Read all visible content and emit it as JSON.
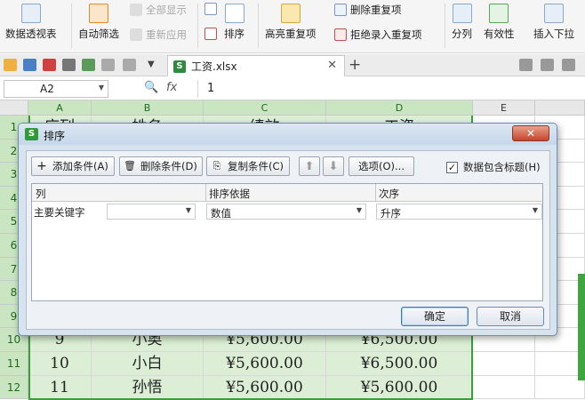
{
  "ribbon": {
    "pivot_table": "数据透视表",
    "auto_filter": "自动筛选",
    "show_all": "全部显示",
    "reapply": "重新应用",
    "sort": "排序",
    "highlight_duplicates": "高亮重复项",
    "remove_duplicates": "删除重复项",
    "reject_duplicates": "拒绝录入重复项",
    "split": "分列",
    "validity": "有效性",
    "insert_dropdown": "插入下拉"
  },
  "tabs": {
    "file_name": "工资.xlsx"
  },
  "formula_bar": {
    "cell_ref": "A2",
    "fx": "fx",
    "value": "1"
  },
  "sheet": {
    "columns": [
      "A",
      "B",
      "C",
      "D",
      "E"
    ],
    "header_row": [
      "序列",
      "姓名",
      "绩效",
      "工资",
      ""
    ],
    "rows": [
      {
        "num": "1",
        "cells": [
          "序列",
          "姓名",
          "绩效",
          "工资",
          ""
        ]
      },
      {
        "num": "2",
        "cells": [
          "",
          "",
          "",
          "",
          ""
        ]
      },
      {
        "num": "3",
        "cells": [
          "",
          "",
          "",
          "",
          ""
        ]
      },
      {
        "num": "4",
        "cells": [
          "",
          "",
          "",
          "",
          ""
        ]
      },
      {
        "num": "5",
        "cells": [
          "",
          "",
          "",
          "",
          ""
        ]
      },
      {
        "num": "6",
        "cells": [
          "",
          "",
          "",
          "",
          ""
        ]
      },
      {
        "num": "7",
        "cells": [
          "",
          "",
          "",
          "",
          ""
        ]
      },
      {
        "num": "8",
        "cells": [
          "",
          "",
          "",
          "",
          ""
        ]
      },
      {
        "num": "9",
        "cells": [
          "",
          "",
          "",
          "",
          ""
        ]
      },
      {
        "num": "10",
        "cells": [
          "9",
          "小奥",
          "¥5,600.00",
          "¥6,500.00",
          ""
        ]
      },
      {
        "num": "11",
        "cells": [
          "10",
          "小白",
          "¥5,600.00",
          "¥6,500.00",
          ""
        ]
      },
      {
        "num": "12",
        "cells": [
          "11",
          "孙悟",
          "¥5,600.00",
          "¥5,600.00",
          ""
        ]
      }
    ]
  },
  "dialog": {
    "title": "排序",
    "close": "✕",
    "add_condition": "添加条件(A)",
    "delete_condition": "删除条件(D)",
    "copy_condition": "复制条件(C)",
    "move_up": "⬆",
    "move_down": "⬇",
    "options": "选项(O)...",
    "header_checkbox": "数据包含标题(H)",
    "header_checked": true,
    "columns": {
      "col": "列",
      "sort_on": "排序依据",
      "order": "次序"
    },
    "condition": {
      "label": "主要关键字",
      "column_value": "",
      "sort_on_value": "数值",
      "order_value": "升序"
    },
    "ok": "确定",
    "cancel": "取消"
  },
  "colors": {
    "selection_green": "#3b9e3b",
    "selected_fill": "#dcefd6",
    "dialog_bg": "#d7e3ef"
  }
}
